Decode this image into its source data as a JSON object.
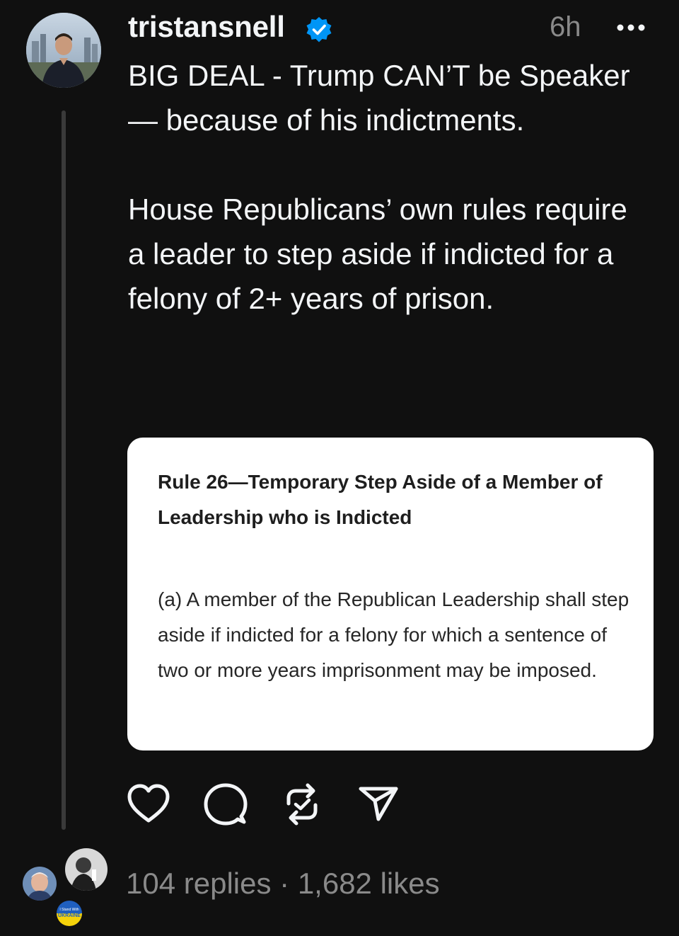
{
  "post": {
    "username": "tristansnell",
    "verified": true,
    "time": "6h",
    "paragraph1": "BIG DEAL - Trump CAN’T be Speaker — because of his indictments.",
    "paragraph2": "House Republicans’ own rules require a leader to step aside if indicted for a felony of 2+ years of prison."
  },
  "card": {
    "heading": "Rule 26—Temporary Step Aside of a Member of Leadership who is Indicted",
    "body": "(a) A member of the Republican Leadership shall step aside if indicted for a felony for which a sentence of two or more years imprisonment may be imposed."
  },
  "actions": {
    "like_icon": "heart-icon",
    "reply_icon": "comment-icon",
    "repost_icon": "repost-icon",
    "share_icon": "send-icon"
  },
  "stats": {
    "replies": "104 replies",
    "separator": "·",
    "likes": "1,682 likes"
  },
  "badge": {
    "line1": "I Stand With",
    "line2": "UKRAINE"
  },
  "colors": {
    "background": "#101010",
    "text": "#f3f5f7",
    "muted": "#8a8a8a",
    "verified": "#0095f6",
    "card": "#ffffff"
  }
}
